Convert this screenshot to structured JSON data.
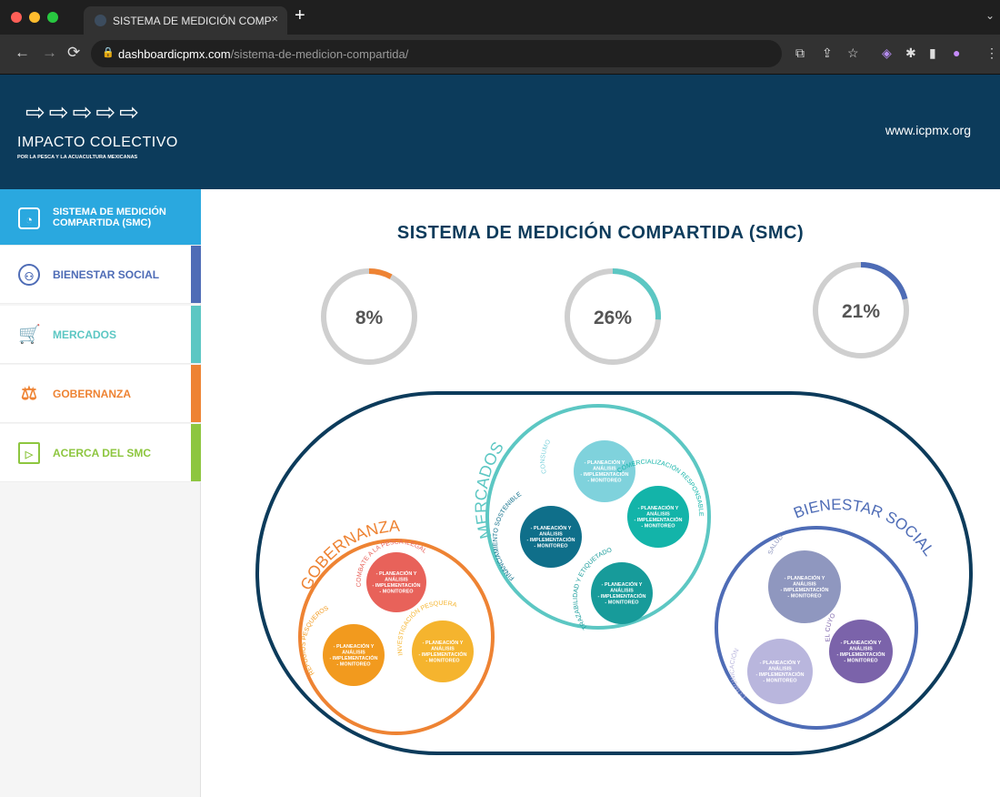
{
  "browser": {
    "tab_title": "SISTEMA DE MEDICIÓN COMP",
    "url_host": "dashboardicpmx.com",
    "url_path": "/sistema-de-medicion-compartida/"
  },
  "header": {
    "logo_title": "IMPACTO COLECTIVO",
    "logo_subtitle": "POR LA PESCA Y LA ACUACULTURA MEXICANAS",
    "site_url": "www.icpmx.org"
  },
  "sidebar": {
    "items": [
      {
        "label": "SISTEMA DE MEDICIÓN COMPARTIDA (SMC)",
        "color": "#2aa8df"
      },
      {
        "label": "BIENESTAR SOCIAL",
        "color": "#4e6cb6"
      },
      {
        "label": "MERCADOS",
        "color": "#5cc7c3"
      },
      {
        "label": "GOBERNANZA",
        "color": "#ee8333"
      },
      {
        "label": "ACERCA DEL SMC",
        "color": "#8dc63f"
      }
    ]
  },
  "main": {
    "title": "SISTEMA DE MEDICIÓN COMPARTIDA (SMC)",
    "gauges": [
      {
        "value": 8,
        "label": "8%",
        "color": "#ee8333"
      },
      {
        "value": 26,
        "label": "26%",
        "color": "#5cc7c3"
      },
      {
        "value": 21,
        "label": "21%",
        "color": "#4e6cb6"
      }
    ]
  },
  "diagram": {
    "phase_lines": [
      "- PLANEACIÓN Y",
      "ANÁLISIS",
      "- IMPLEMENTACIÓN",
      "- MONITOREO"
    ],
    "groups": [
      {
        "title": "GOBERNANZA",
        "color": "#ee8333",
        "subs": [
          {
            "name": "COMBATE A LA PESCA ILEGAL",
            "color": "#e8625a"
          },
          {
            "name": "REFUGIOS PESQUEROS",
            "color": "#f29a1e"
          },
          {
            "name": "INVESTIGACIÓN PESQUERA",
            "color": "#f5b42e"
          }
        ]
      },
      {
        "title": "MERCADOS",
        "color": "#5cc7c3",
        "subs": [
          {
            "name": "CONSUMO",
            "color": "#7fd2dc"
          },
          {
            "name": "COMERCIALIZACIÓN RESPONSABLE",
            "color": "#13b4a9"
          },
          {
            "name": "FINANCIAMIENTO SOSTENIBLE",
            "color": "#0f6f8a"
          },
          {
            "name": "TRAZABILIDAD Y ETIQUETADO",
            "color": "#179b9a"
          }
        ]
      },
      {
        "title": "BIENESTAR SOCIAL",
        "color": "#4e6cb6",
        "subs": [
          {
            "name": "SALUD",
            "color": "#8f97bf"
          },
          {
            "name": "EL CUYO",
            "color": "#7b63aa"
          },
          {
            "name": "COMUNICACIÓN",
            "color": "#b9b6dd"
          }
        ]
      }
    ]
  }
}
